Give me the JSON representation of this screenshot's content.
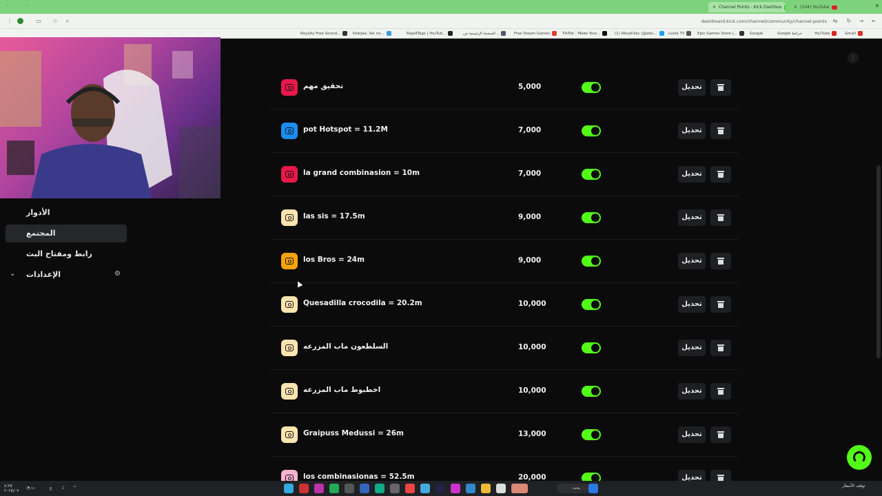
{
  "browser": {
    "tabs": [
      {
        "label": "Channel Points - Kick Dashboa",
        "active": true
      },
      {
        "label": "(104) YouTube",
        "active": false
      }
    ],
    "url": "dashboard.kick.com/channel/community/channel-points",
    "bookmarks": [
      "Royalty Free Sound...",
      "Kkeijaa: Sei no...",
      "RapidTags | YouTub...",
      "الصفحة الرئيسية من...",
      "Free Steam Games",
      "TikTok - Make Your...",
      "(1) Abuali3ac (@abu...",
      "Loola TV",
      "Epic Games Store |...",
      "Google",
      "Google خرائط",
      "YouTube",
      "Gmail"
    ]
  },
  "sidebar": {
    "items": [
      {
        "label": "الأدوار",
        "active": false
      },
      {
        "label": "المجتمع",
        "active": true
      },
      {
        "label": "رابط ومفتاح البث",
        "active": false
      },
      {
        "label": "الإعدادات",
        "active": false
      }
    ]
  },
  "rewards": [
    {
      "title": "تحقيق مهم",
      "cost": "5,000",
      "color": "#e8194a",
      "enabled": true
    },
    {
      "title": "pot Hotspot = 11.2M",
      "cost": "7,000",
      "color": "#1d8cf0",
      "enabled": true
    },
    {
      "title": "la grand combinasion = 10m",
      "cost": "7,000",
      "color": "#e8194a",
      "enabled": true
    },
    {
      "title": "las sis = 17.5m",
      "cost": "9,000",
      "color": "#ffe4b0",
      "enabled": true
    },
    {
      "title": "los Bros = 24m",
      "cost": "9,000",
      "color": "#f5a20a",
      "enabled": true
    },
    {
      "title": "Quesadilla crocodila = 20.2m",
      "cost": "10,000",
      "color": "#ffe4b0",
      "enabled": true
    },
    {
      "title": "السلطعون ماب المزرعه",
      "cost": "10,000",
      "color": "#ffe4b0",
      "enabled": true
    },
    {
      "title": "اخطبوط ماب المزرعه",
      "cost": "10,000",
      "color": "#ffe4b0",
      "enabled": true
    },
    {
      "title": "Graipuss Medussi = 26m",
      "cost": "13,000",
      "color": "#ffe4b0",
      "enabled": true
    },
    {
      "title": "los combinasionas = 52.5m",
      "cost": "20,000",
      "color": "#f8b4d0",
      "enabled": true
    }
  ],
  "labels": {
    "edit": "تحديل"
  },
  "taskbar": {
    "search_label": "بحث",
    "weather": "توقف الأمطار",
    "lang": "ع"
  }
}
